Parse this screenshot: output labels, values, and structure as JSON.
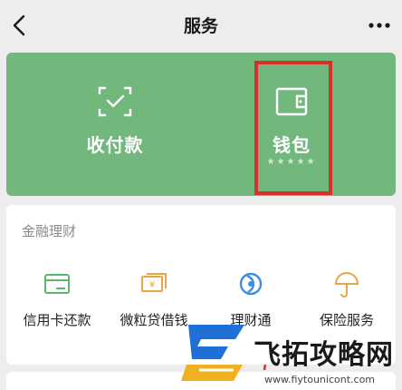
{
  "header": {
    "title": "服务",
    "back_icon": "chevron-left-icon",
    "more_icon": "more-dots-icon"
  },
  "hero": {
    "pay": {
      "label": "收付款",
      "icon": "scan-check-icon"
    },
    "wallet": {
      "label": "钱包",
      "stars": "★★★★★",
      "icon": "wallet-icon"
    },
    "background_color": "#72b77b",
    "highlight_color": "#d9302c"
  },
  "finance": {
    "title": "金融理财",
    "items": [
      {
        "label": "信用卡还款",
        "icon": "credit-card-icon",
        "color": "#5cb86b"
      },
      {
        "label": "微粒贷借钱",
        "icon": "loan-icon",
        "color": "#e8a646"
      },
      {
        "label": "理财通",
        "icon": "wealth-icon",
        "color": "#3a8ee6"
      },
      {
        "label": "保险服务",
        "icon": "umbrella-icon",
        "color": "#e8a646"
      }
    ]
  },
  "watermark": {
    "brand": "飞拓攻略网",
    "url": "www.fiytounicont.com"
  }
}
